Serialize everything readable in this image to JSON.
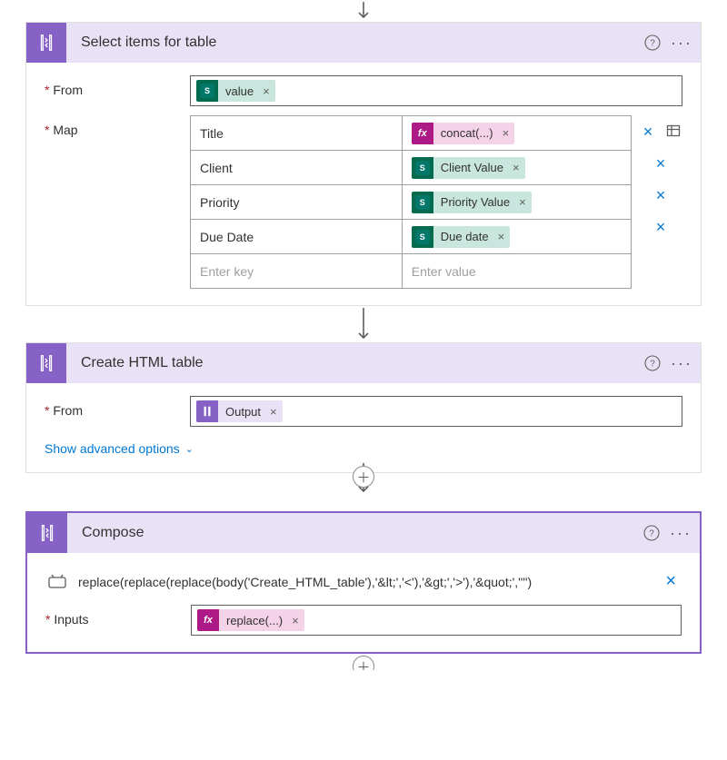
{
  "cards": {
    "select": {
      "title": "Select items for table",
      "from_label": "From",
      "from_token": "value",
      "map_label": "Map",
      "rows": [
        {
          "key": "Title",
          "token_kind": "fx",
          "token_label": "concat(...)"
        },
        {
          "key": "Client",
          "token_kind": "sp",
          "token_label": "Client Value"
        },
        {
          "key": "Priority",
          "token_kind": "sp",
          "token_label": "Priority Value"
        },
        {
          "key": "Due Date",
          "token_kind": "sp",
          "token_label": "Due date"
        }
      ],
      "key_placeholder": "Enter key",
      "value_placeholder": "Enter value"
    },
    "html": {
      "title": "Create HTML table",
      "from_label": "From",
      "from_token": "Output",
      "adv": "Show advanced options"
    },
    "compose": {
      "title": "Compose",
      "expression": "replace(replace(replace(body('Create_HTML_table'),'&lt;','<'),'&gt;','>'),'&quot;','\"')",
      "inputs_label": "Inputs",
      "inputs_token": "replace(...)"
    }
  },
  "glyphs": {
    "fx": "fx",
    "question": "?",
    "ellipsis": "···",
    "times": "×",
    "plus": "＋"
  }
}
